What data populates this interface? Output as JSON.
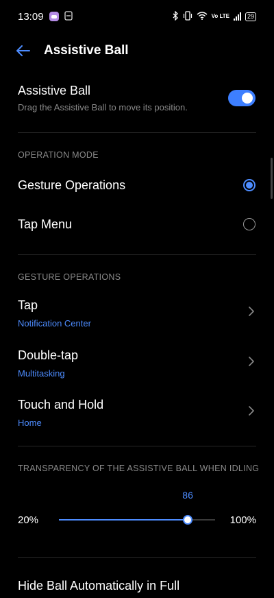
{
  "status_bar": {
    "time": "13:09",
    "signal_type": "Vo LTE",
    "battery": "29",
    "icons": [
      "app-notification-icon",
      "do-not-disturb-icon",
      "bluetooth-icon",
      "vibrate-icon",
      "wifi-icon",
      "signal-icon",
      "battery-icon"
    ]
  },
  "header": {
    "title": "Assistive Ball",
    "back_icon": "back-arrow-icon"
  },
  "master": {
    "title": "Assistive Ball",
    "description": "Drag the Assistive Ball to move its position.",
    "enabled": true
  },
  "operation_mode": {
    "label": "OPERATION MODE",
    "options": [
      {
        "label": "Gesture Operations",
        "selected": true
      },
      {
        "label": "Tap Menu",
        "selected": false
      }
    ]
  },
  "gesture_operations": {
    "label": "GESTURE OPERATIONS",
    "items": [
      {
        "title": "Tap",
        "value": "Notification Center"
      },
      {
        "title": "Double-tap",
        "value": "Multitasking"
      },
      {
        "title": "Touch and Hold",
        "value": "Home"
      }
    ]
  },
  "transparency": {
    "label": "TRANSPARENCY OF THE ASSISTIVE BALL WHEN IDLING",
    "min_label": "20%",
    "max_label": "100%",
    "min": 20,
    "max": 100,
    "value": 86,
    "value_label": "86"
  },
  "hide_ball": {
    "title": "Hide Ball Automatically in Full"
  },
  "colors": {
    "accent": "#4d8cff",
    "background": "#000000",
    "muted": "#8a8a8a",
    "divider": "#2a2a2a"
  }
}
